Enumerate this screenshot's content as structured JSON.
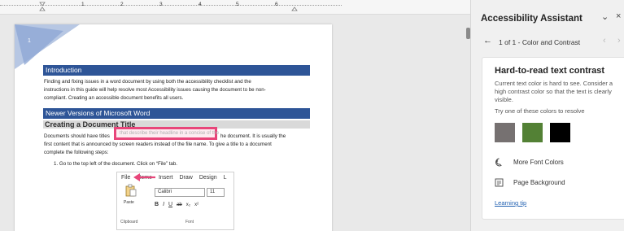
{
  "ruler": {
    "numbers": [
      "1",
      "2",
      "3",
      "4",
      "5",
      "6"
    ]
  },
  "document": {
    "page_number": "1",
    "heading_intro": "Introduction",
    "para_intro_1": "Finding and fixing issues in a word document by using both the accessibility checklist and the",
    "para_intro_2": "instructions in this guide will help resolve most Accessibility issues causing the document to be non-",
    "para_intro_3": "compliant. Creating an accessible document benefits all users.",
    "heading_newer": "Newer Versions of Microsoft Word",
    "heading_title": "Creating a Document Title",
    "para_title_1a": "Documents should have titles",
    "para_title_1b": "he document. It is usually the",
    "para_title_2": "first content that is announced by screen readers instead of the file name. To give a title to a document",
    "para_title_3": "complete the following steps:",
    "highlighted_text": "that describe their headline in a concise of the",
    "step_1": "1.   Go to the top left of the document. Click on “File” tab.",
    "ribbon": {
      "tabs": [
        "File",
        "Home",
        "Insert",
        "Draw",
        "Design",
        "L"
      ],
      "paste_label": "Paste",
      "clipboard_label": "Clipboard",
      "font_name": "Calibri",
      "font_size": "11",
      "font_group_label": "Font",
      "format_buttons": [
        "B",
        "I",
        "U",
        "ab",
        "x₂",
        "x²"
      ]
    }
  },
  "pane": {
    "title": "Accessibility Assistant",
    "nav_text": "1 of 1 - Color and Contrast",
    "card": {
      "title": "Hard-to-read text contrast",
      "description": "Current text color is hard to see. Consider a high contrast color so that the text is clearly visible.",
      "try_label": "Try one of these colors to resolve",
      "swatches": [
        "#767171",
        "#538135",
        "#000000"
      ],
      "more_colors": "More Font Colors",
      "page_background": "Page Background",
      "learning_tip": "Learning tip"
    }
  },
  "colors": {
    "heading_bar": "#2e5597",
    "highlight": "#e8457a",
    "link": "#1f5fb0"
  }
}
